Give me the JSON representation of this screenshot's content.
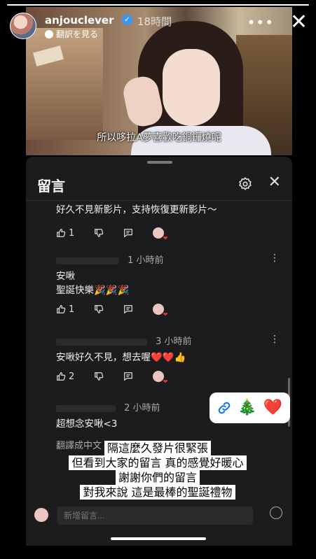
{
  "story": {
    "progress": 1.0,
    "username": "anjouclever",
    "verified_glyph": "✓",
    "timestamp": "18時間",
    "translate_label": "翻訳を見る",
    "more_glyph": "•••",
    "close_glyph": "✕"
  },
  "video": {
    "subtitle": "所以哆拉A夢喜歡吃銅鑼燒呢"
  },
  "comments_panel": {
    "title": "留言",
    "close_glyph": "✕",
    "comments": [
      {
        "meta": "",
        "lines": [
          "好久不見新影片，支持恢復更新影片～"
        ],
        "likes": "1"
      },
      {
        "meta": "1 小時前",
        "lines": [
          "安啾",
          "聖誕快樂🎉🎉🎉"
        ],
        "likes": "1"
      },
      {
        "meta": "3 小時前",
        "lines": [
          "安啾好久不見，想去喔❤️❤️👍"
        ],
        "likes": "2"
      },
      {
        "meta": "2 小時前",
        "lines": [
          "超想念安啾<3"
        ],
        "likes": ""
      }
    ],
    "partial_line": "翻譯成中文 (台灣)",
    "reply_placeholder": "新增留言..."
  },
  "sticker": {
    "emojis": [
      "🎄",
      "❤️"
    ]
  },
  "caption": {
    "lines": [
      "隔這麼久發片很緊張",
      "但看到大家的留言 真的感覺好暖心",
      "謝謝你們的留言",
      "對我來說 這是最棒的聖誕禮物"
    ]
  },
  "icons": {
    "like": "thumbs-up-icon",
    "dislike": "thumbs-down-icon",
    "reply": "reply-icon",
    "settings": "gear-icon",
    "link": "link-icon"
  },
  "colors": {
    "panel_bg": "#1c1c1e",
    "verified": "#3897f0",
    "link_blue": "#1877f2"
  }
}
